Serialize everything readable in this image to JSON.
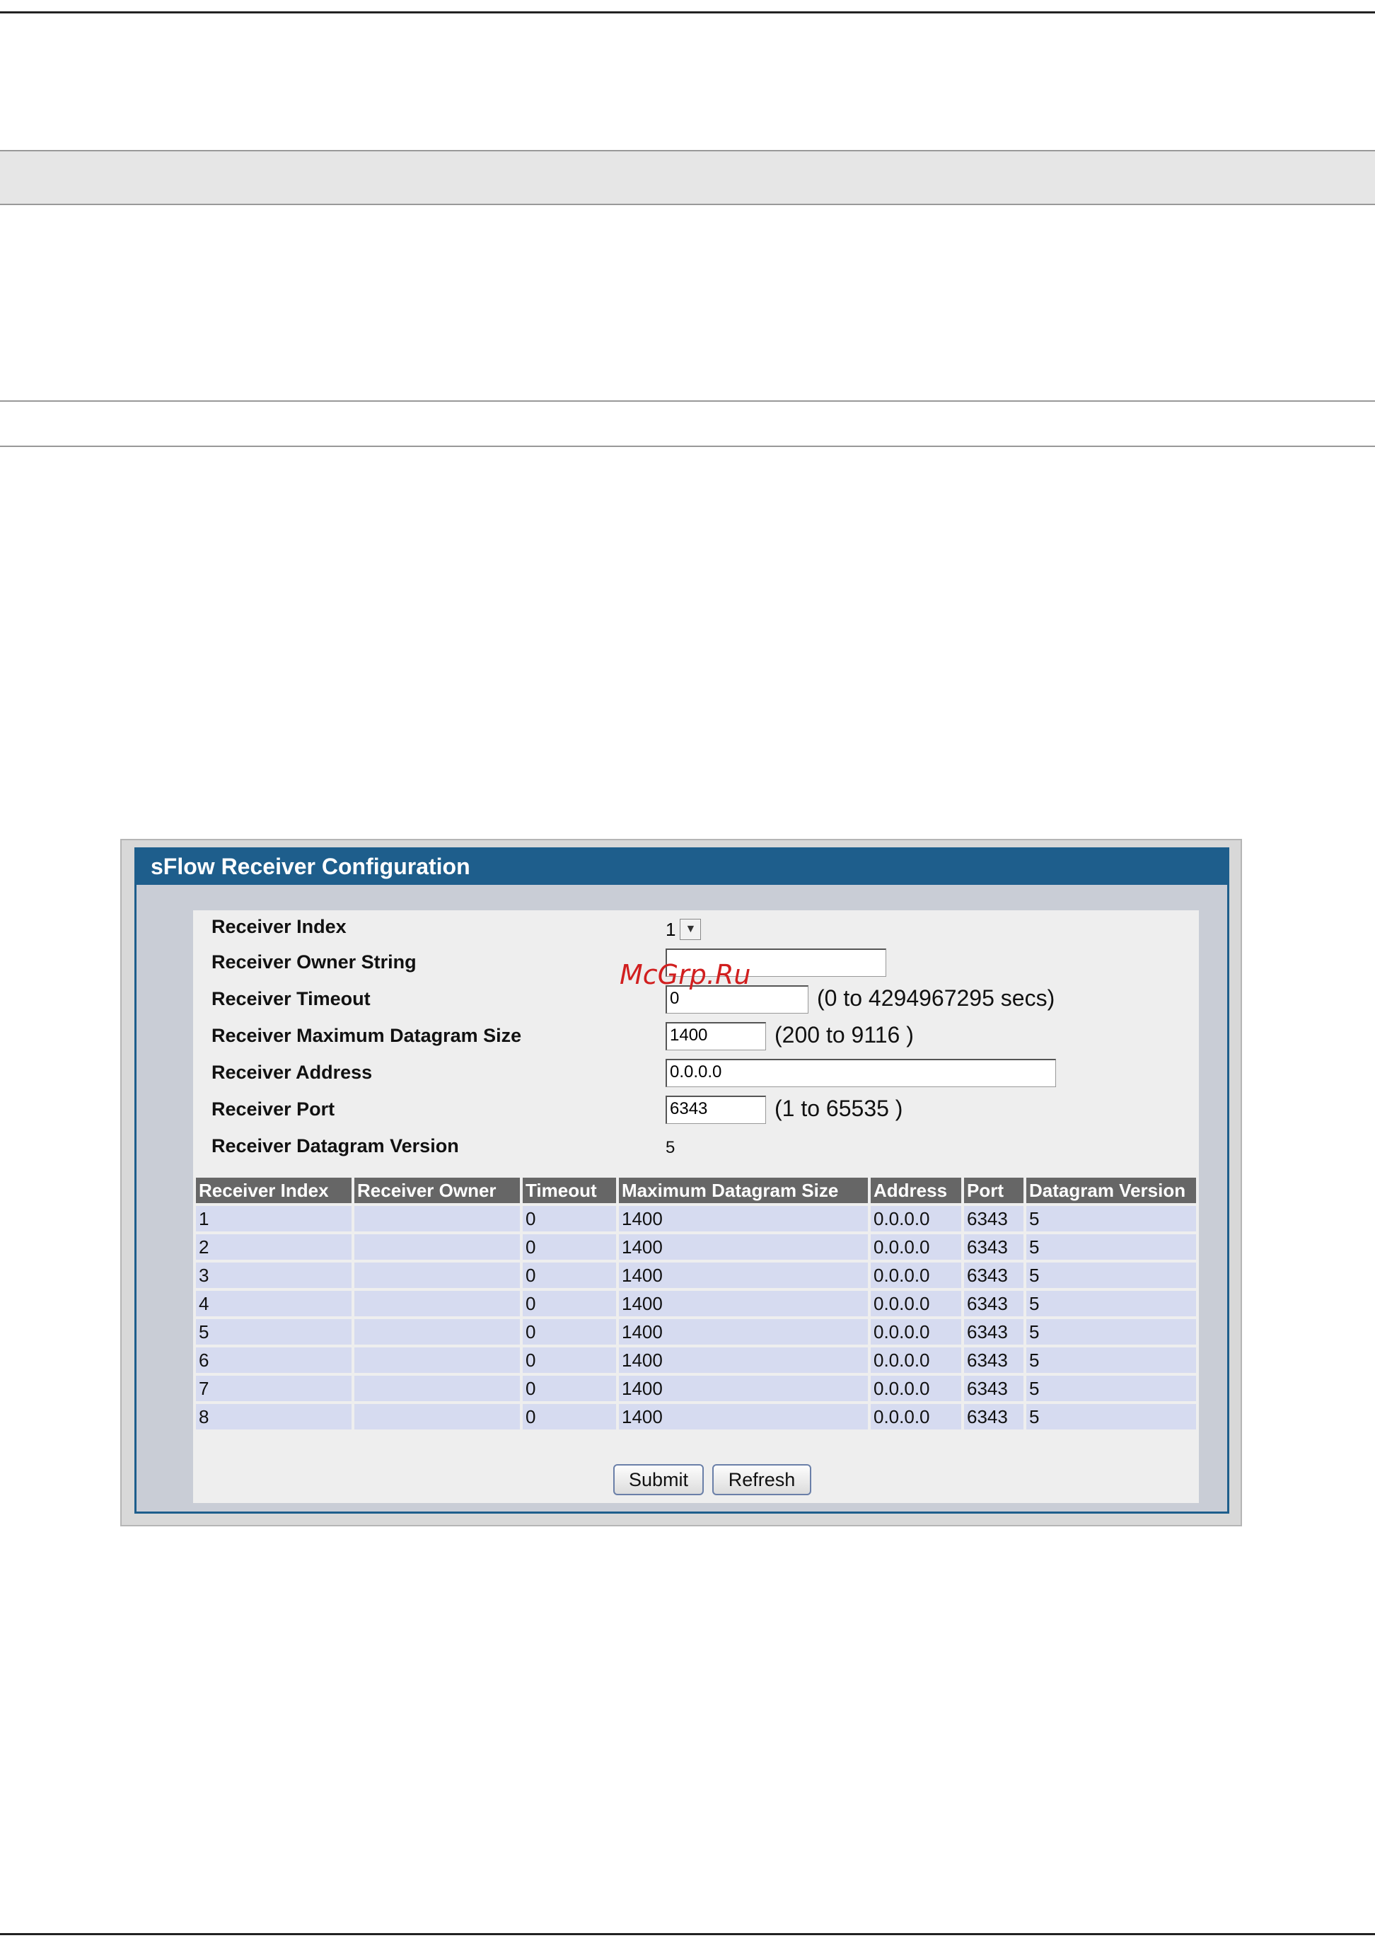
{
  "panel": {
    "title": "sFlow Receiver Configuration"
  },
  "form": {
    "receiver_index": {
      "label": "Receiver Index",
      "value": "1"
    },
    "owner_string": {
      "label": "Receiver Owner String",
      "value": ""
    },
    "timeout": {
      "label": "Receiver Timeout",
      "value": "0",
      "hint": "(0 to 4294967295 secs)"
    },
    "max_datagram": {
      "label": "Receiver Maximum Datagram Size",
      "value": "1400",
      "hint": "(200 to 9116 )"
    },
    "address": {
      "label": "Receiver Address",
      "value": "0.0.0.0"
    },
    "port": {
      "label": "Receiver Port",
      "value": "6343",
      "hint": "(1 to 65535 )"
    },
    "datagram_version": {
      "label": "Receiver Datagram Version",
      "value": "5"
    }
  },
  "table": {
    "headers": [
      "Receiver Index",
      "Receiver Owner",
      "Timeout",
      "Maximum Datagram Size",
      "Address",
      "Port",
      "Datagram Version"
    ],
    "rows": [
      [
        "1",
        "",
        "0",
        "1400",
        "0.0.0.0",
        "6343",
        "5"
      ],
      [
        "2",
        "",
        "0",
        "1400",
        "0.0.0.0",
        "6343",
        "5"
      ],
      [
        "3",
        "",
        "0",
        "1400",
        "0.0.0.0",
        "6343",
        "5"
      ],
      [
        "4",
        "",
        "0",
        "1400",
        "0.0.0.0",
        "6343",
        "5"
      ],
      [
        "5",
        "",
        "0",
        "1400",
        "0.0.0.0",
        "6343",
        "5"
      ],
      [
        "6",
        "",
        "0",
        "1400",
        "0.0.0.0",
        "6343",
        "5"
      ],
      [
        "7",
        "",
        "0",
        "1400",
        "0.0.0.0",
        "6343",
        "5"
      ],
      [
        "8",
        "",
        "0",
        "1400",
        "0.0.0.0",
        "6343",
        "5"
      ]
    ]
  },
  "buttons": {
    "submit": "Submit",
    "refresh": "Refresh"
  },
  "watermark": "McGrp.Ru",
  "colors": {
    "title_bar": "#1e5e8c",
    "header_bg": "#666666",
    "row_bg": "#d6dbf0"
  },
  "icons": {
    "select_arrow": "chevron-down-icon"
  }
}
